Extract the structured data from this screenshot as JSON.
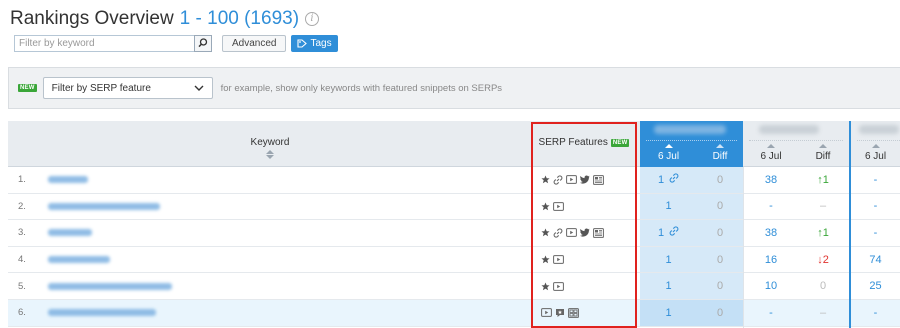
{
  "header": {
    "title": "Rankings Overview",
    "range": "1 - 100 (1693)",
    "info_icon": "info-icon"
  },
  "toolbar": {
    "filter_placeholder": "Filter by keyword",
    "advanced_label": "Advanced",
    "tags_label": "Tags"
  },
  "serp_bar": {
    "new_badge": "NEW",
    "select_label": "Filter by SERP feature",
    "hint": "for example, show only keywords with featured snippets on SERPs"
  },
  "table": {
    "keyword_header": "Keyword",
    "serp_header": "SERP Features",
    "serp_new_badge": "NEW",
    "domains": [
      {
        "date_label": "6 Jul",
        "diff_label": "Diff"
      },
      {
        "date_label": "6 Jul",
        "diff_label": "Diff"
      },
      {
        "date_label": "6 Jul"
      }
    ],
    "rows": [
      {
        "num": "1.",
        "serp_icons": [
          "star-icon",
          "link-icon",
          "video-icon",
          "twitter-icon",
          "news-icon"
        ],
        "pos1": "1",
        "pos1_link": true,
        "diff1": "0",
        "pos2": "38",
        "diff2": "↑1",
        "diff2_type": "up",
        "pos3": "-",
        "kw_width": 40
      },
      {
        "num": "2.",
        "serp_icons": [
          "star-icon",
          "video-icon"
        ],
        "pos1": "1",
        "pos1_link": false,
        "diff1": "0",
        "pos2": "-",
        "diff2": "–",
        "diff2_type": "dash",
        "pos3": "-",
        "kw_width": 112
      },
      {
        "num": "3.",
        "serp_icons": [
          "star-icon",
          "link-icon",
          "video-icon",
          "twitter-icon",
          "news-icon"
        ],
        "pos1": "1",
        "pos1_link": true,
        "diff1": "0",
        "pos2": "38",
        "diff2": "↑1",
        "diff2_type": "up",
        "pos3": "-",
        "kw_width": 44
      },
      {
        "num": "4.",
        "serp_icons": [
          "star-icon",
          "video-icon"
        ],
        "pos1": "1",
        "pos1_link": false,
        "diff1": "0",
        "pos2": "16",
        "diff2": "↓2",
        "diff2_type": "down",
        "pos3": "74",
        "kw_width": 62
      },
      {
        "num": "5.",
        "serp_icons": [
          "star-icon",
          "video-icon"
        ],
        "pos1": "1",
        "pos1_link": false,
        "diff1": "0",
        "pos2": "10",
        "diff2": "0",
        "diff2_type": "zero",
        "pos3": "25",
        "kw_width": 124
      },
      {
        "num": "6.",
        "serp_icons": [
          "video-icon",
          "review-icon",
          "image-icon"
        ],
        "pos1": "1",
        "pos1_link": false,
        "diff1": "0",
        "pos2": "-",
        "diff2": "–",
        "diff2_type": "dash",
        "pos3": "-",
        "kw_width": 108
      }
    ]
  },
  "colors": {
    "accent": "#2f8ed8",
    "highlight_outline": "#e0221e",
    "new_badge": "#3aa639",
    "up": "#3aa639",
    "down": "#e0342f"
  }
}
